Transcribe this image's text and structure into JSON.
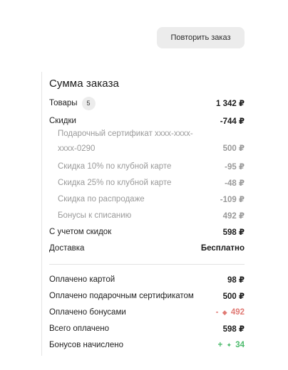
{
  "actions": {
    "repeat_order": "Повторить заказ"
  },
  "summary": {
    "title": "Сумма заказа",
    "goods": {
      "label": "Товары",
      "count": "5",
      "value": "1 342 ₽"
    },
    "discounts": {
      "label": "Скидки",
      "value": "-744 ₽"
    },
    "discount_items": [
      {
        "label": "Подарочный сертификат хххх-хххх-хххх-0290",
        "value": "500 ₽"
      },
      {
        "label": "Скидка 10% по клубной карте",
        "value": "-95 ₽"
      },
      {
        "label": "Скидка 25% по клубной карте",
        "value": "-48 ₽"
      },
      {
        "label": "Скидка по распродаже",
        "value": "-109 ₽"
      },
      {
        "label": "Бонусы к списанию",
        "value": "492 ₽"
      }
    ],
    "with_discounts": {
      "label": "С учетом скидок",
      "value": "598 ₽"
    },
    "delivery": {
      "label": "Доставка",
      "value": "Бесплатно"
    }
  },
  "payments": {
    "card": {
      "label": "Оплачено картой",
      "value": "98 ₽"
    },
    "certificate": {
      "label": "Оплачено подарочным сертификатом",
      "value": "500 ₽"
    },
    "bonuses": {
      "label": "Оплачено бонусами",
      "sign": "-",
      "icon": "bonus-diamond-icon",
      "value": "492",
      "color": "#e07a74"
    },
    "total": {
      "label": "Всего оплачено",
      "value": "598 ₽"
    },
    "accrued": {
      "label": "Бонусов начислено",
      "sign": "+",
      "icon": "bonus-diamond-icon",
      "value": "34",
      "color": "#4cbb6c"
    }
  }
}
